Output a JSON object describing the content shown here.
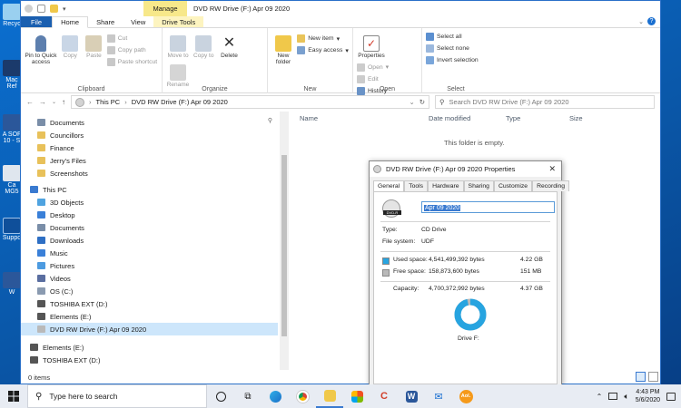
{
  "desktop": {
    "icons": [
      {
        "label": "Recyc"
      },
      {
        "label": "Mac"
      },
      {
        "label": "Ref"
      },
      {
        "label": "A SOF"
      },
      {
        "label": "10 - S"
      },
      {
        "label": "Ca"
      },
      {
        "label": "MG5"
      },
      {
        "label": "Suppo"
      },
      {
        "label": "W"
      }
    ]
  },
  "window": {
    "title": "DVD RW Drive (F:) Apr 09 2020",
    "manage_tab": "Manage",
    "tabs": [
      "File",
      "Home",
      "Share",
      "View",
      "Drive Tools"
    ]
  },
  "ribbon": {
    "clipboard": {
      "label": "Clipboard",
      "pin": "Pin to Quick access",
      "copy": "Copy",
      "paste": "Paste",
      "cut": "Cut",
      "copy_path": "Copy path",
      "paste_shortcut": "Paste shortcut"
    },
    "organize": {
      "label": "Organize",
      "move_to": "Move to",
      "copy_to": "Copy to",
      "delete": "Delete",
      "rename": "Rename"
    },
    "new": {
      "label": "New",
      "new_folder": "New folder",
      "new_item": "New item",
      "easy_access": "Easy access"
    },
    "open": {
      "label": "Open",
      "properties": "Properties",
      "open": "Open",
      "edit": "Edit",
      "history": "History"
    },
    "select": {
      "label": "Select",
      "select_all": "Select all",
      "select_none": "Select none",
      "invert": "Invert selection"
    }
  },
  "address": {
    "path": [
      "This PC",
      "DVD RW Drive (F:) Apr 09 2020"
    ],
    "search_placeholder": "Search DVD RW Drive (F:) Apr 09 2020"
  },
  "nav": {
    "items": [
      {
        "label": "Documents",
        "color": "#7a8ea8",
        "indent": 1
      },
      {
        "label": "Councillors",
        "color": "#e8c15a",
        "indent": 1
      },
      {
        "label": "Finance",
        "color": "#e8c15a",
        "indent": 1
      },
      {
        "label": "Jerry's Files",
        "color": "#e8c15a",
        "indent": 1
      },
      {
        "label": "Screenshots",
        "color": "#e8c15a",
        "indent": 1
      },
      {
        "label": "This PC",
        "color": "#3a7ad0",
        "indent": 0
      },
      {
        "label": "3D Objects",
        "color": "#4fa3e0",
        "indent": 1
      },
      {
        "label": "Desktop",
        "color": "#3a80d8",
        "indent": 1
      },
      {
        "label": "Documents",
        "color": "#7a8ea8",
        "indent": 1
      },
      {
        "label": "Downloads",
        "color": "#2e6fc4",
        "indent": 1
      },
      {
        "label": "Music",
        "color": "#3a80d8",
        "indent": 1
      },
      {
        "label": "Pictures",
        "color": "#4d9be0",
        "indent": 1
      },
      {
        "label": "Videos",
        "color": "#5a6ea0",
        "indent": 1
      },
      {
        "label": "OS (C:)",
        "color": "#8a9ab0",
        "indent": 1
      },
      {
        "label": "TOSHIBA EXT (D:)",
        "color": "#555555",
        "indent": 1
      },
      {
        "label": "Elements (E:)",
        "color": "#555555",
        "indent": 1
      },
      {
        "label": "DVD RW Drive (F:) Apr 09 2020",
        "color": "#b9b9b9",
        "indent": 1,
        "selected": true
      },
      {
        "label": "Elements (E:)",
        "color": "#555555",
        "indent": 0
      },
      {
        "label": "TOSHIBA EXT (D:)",
        "color": "#555555",
        "indent": 0
      }
    ]
  },
  "files": {
    "columns": [
      "Name",
      "Date modified",
      "Type",
      "Size"
    ],
    "empty_text": "This folder is empty."
  },
  "status": {
    "items": "0 items"
  },
  "properties": {
    "title": "DVD RW Drive (F:) Apr 09 2020 Properties",
    "tabs": [
      "General",
      "Tools",
      "Hardware",
      "Sharing",
      "Customize",
      "Recording"
    ],
    "drive_icon_text": "DVD-R",
    "label_value": "Apr 09 2020",
    "type_label": "Type:",
    "type_value": "CD Drive",
    "fs_label": "File system:",
    "fs_value": "UDF",
    "used_label": "Used space:",
    "used_bytes": "4,541,499,392 bytes",
    "used_gb": "4.22 GB",
    "free_label": "Free space:",
    "free_bytes": "158,873,600 bytes",
    "free_mb": "151 MB",
    "cap_label": "Capacity:",
    "cap_bytes": "4,700,372,992 bytes",
    "cap_gb": "4.37 GB",
    "drive_label": "Drive F:",
    "used_fraction": 0.966,
    "used_color": "#27a4e0",
    "free_color": "#b9b9b9"
  },
  "taskbar": {
    "search_placeholder": "Type here to search",
    "time": "4:43 PM",
    "date": "5/6/2020",
    "aol": "Aol."
  }
}
